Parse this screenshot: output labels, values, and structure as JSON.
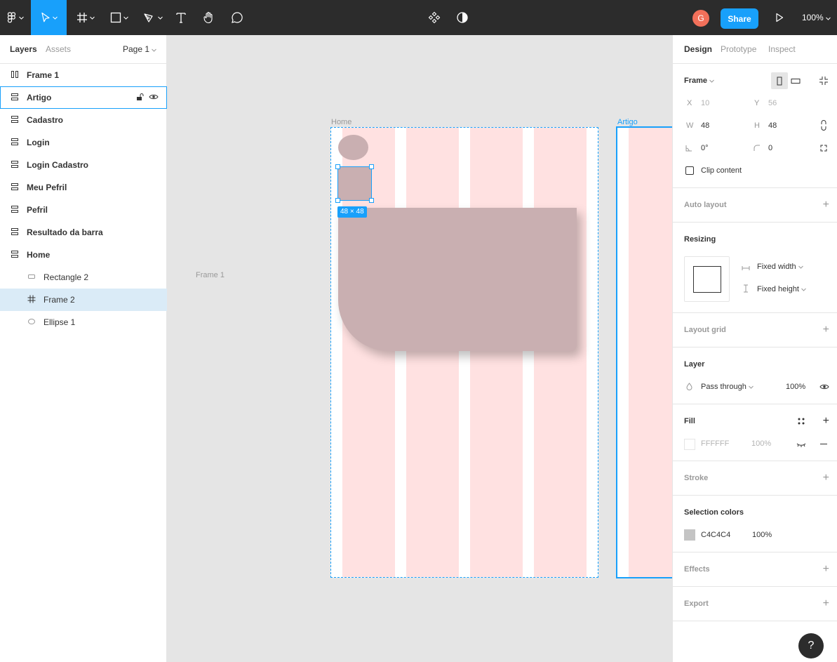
{
  "toolbar": {
    "avatar_initial": "G",
    "share_label": "Share",
    "zoom_label": "100%",
    "active_tool": "move-tool",
    "icons": [
      "figma-menu-icon",
      "move-icon",
      "frame-icon",
      "rectangle-icon",
      "pen-icon",
      "text-icon",
      "hand-icon",
      "comment-icon",
      "component-icon",
      "contrast-icon",
      "play-icon"
    ]
  },
  "left_panel": {
    "tabs": {
      "layers": "Layers",
      "assets": "Assets",
      "page": "Page 1"
    },
    "layers": [
      {
        "label": "Frame 1",
        "icon": "columns-icon",
        "state": "normal",
        "indent": 0
      },
      {
        "label": "Artigo",
        "icon": "rows-icon",
        "state": "hover",
        "indent": 0
      },
      {
        "label": "Cadastro",
        "icon": "rows-icon",
        "state": "normal",
        "indent": 0
      },
      {
        "label": "Login",
        "icon": "rows-icon",
        "state": "normal",
        "indent": 0
      },
      {
        "label": "Login Cadastro",
        "icon": "rows-icon",
        "state": "normal",
        "indent": 0
      },
      {
        "label": "Meu Pefril",
        "icon": "rows-icon",
        "state": "normal",
        "indent": 0
      },
      {
        "label": "Pefril",
        "icon": "rows-icon",
        "state": "normal",
        "indent": 0
      },
      {
        "label": "Resultado da barra",
        "icon": "rows-icon",
        "state": "normal",
        "indent": 0
      },
      {
        "label": "Home",
        "icon": "rows-icon",
        "state": "normal",
        "indent": 0
      },
      {
        "label": "Rectangle 2",
        "icon": "rectangle-layer-icon",
        "state": "normal",
        "indent": 1
      },
      {
        "label": "Frame 2",
        "icon": "frame-layer-icon",
        "state": "selected",
        "indent": 1
      },
      {
        "label": "Ellipse 1",
        "icon": "ellipse-layer-icon",
        "state": "normal",
        "indent": 1
      }
    ]
  },
  "canvas": {
    "frame1_label": "Frame 1",
    "home_label": "Home",
    "artigo_label": "Artigo",
    "size_badge": "48 × 48",
    "colors": {
      "column": "#ffe1e1",
      "shape": "#c9afb1",
      "selection": "#18a0fb"
    }
  },
  "right_panel": {
    "tabs": {
      "design": "Design",
      "prototype": "Prototype",
      "inspect": "Inspect"
    },
    "frame": {
      "title": "Frame",
      "x_label": "X",
      "x": "10",
      "y_label": "Y",
      "y": "56",
      "w_label": "W",
      "w": "48",
      "h_label": "H",
      "h": "48",
      "rotation": "0°",
      "radius": "0",
      "clip_label": "Clip content"
    },
    "auto_layout": "Auto layout",
    "resizing": {
      "title": "Resizing",
      "width": "Fixed width",
      "height": "Fixed height"
    },
    "layout_grid": "Layout grid",
    "layer": {
      "title": "Layer",
      "blend": "Pass through",
      "opacity": "100%"
    },
    "fill": {
      "title": "Fill",
      "hex": "FFFFFF",
      "opacity": "100%",
      "swatch": "#ffffff"
    },
    "stroke": "Stroke",
    "selection_colors": {
      "title": "Selection colors",
      "hex": "C4C4C4",
      "opacity": "100%",
      "swatch": "#c4c4c4"
    },
    "effects": "Effects",
    "export": "Export",
    "help": "?"
  }
}
